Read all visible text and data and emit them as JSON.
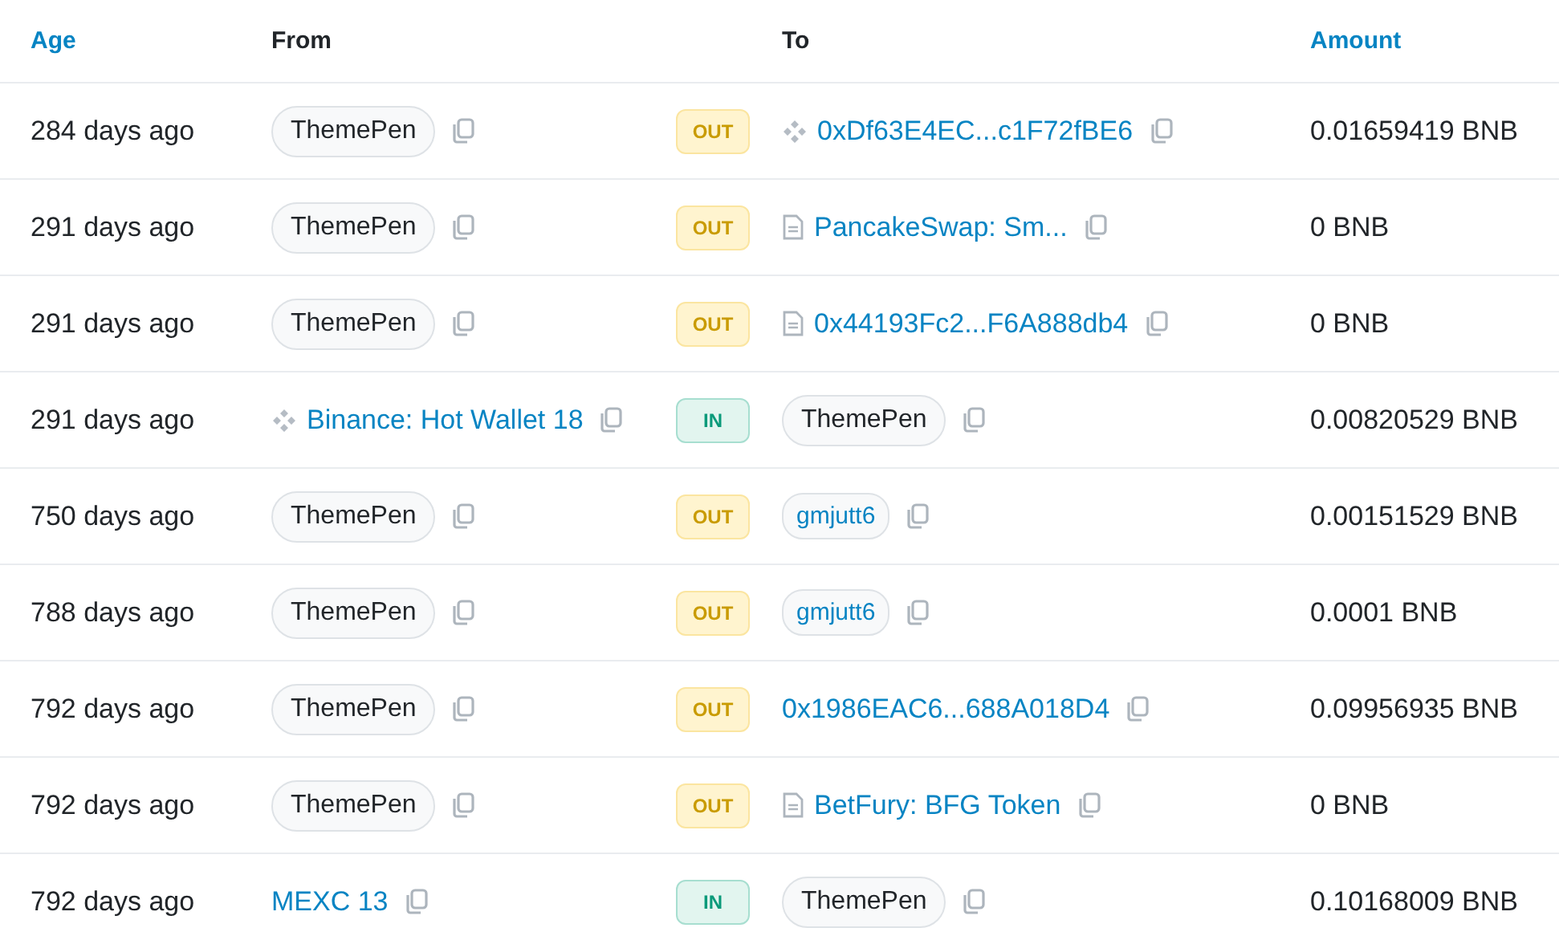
{
  "columns": [
    {
      "label": "Age",
      "kind": "link"
    },
    {
      "label": "From",
      "kind": "plain"
    },
    {
      "label": "To",
      "kind": "plain"
    },
    {
      "label": "Amount",
      "kind": "link"
    }
  ],
  "rows": [
    {
      "age": "284 days ago",
      "from": {
        "text": "ThemePen",
        "kind": "pill"
      },
      "direction": {
        "label": "OUT",
        "kind": "out"
      },
      "to": {
        "text": "0xDf63E4EC...c1F72fBE6",
        "kind": "exchange-link"
      },
      "amount": "0.01659419 BNB"
    },
    {
      "age": "291 days ago",
      "from": {
        "text": "ThemePen",
        "kind": "pill"
      },
      "direction": {
        "label": "OUT",
        "kind": "out"
      },
      "to": {
        "text": "PancakeSwap: Sm...",
        "kind": "contract-link"
      },
      "amount": "0 BNB"
    },
    {
      "age": "291 days ago",
      "from": {
        "text": "ThemePen",
        "kind": "pill"
      },
      "direction": {
        "label": "OUT",
        "kind": "out"
      },
      "to": {
        "text": "0x44193Fc2...F6A888db4",
        "kind": "contract-link"
      },
      "amount": "0 BNB"
    },
    {
      "age": "291 days ago",
      "from": {
        "text": "Binance: Hot Wallet 18",
        "kind": "exchange-link"
      },
      "direction": {
        "label": "IN",
        "kind": "in"
      },
      "to": {
        "text": "ThemePen",
        "kind": "pill"
      },
      "amount": "0.00820529 BNB"
    },
    {
      "age": "750 days ago",
      "from": {
        "text": "ThemePen",
        "kind": "pill"
      },
      "direction": {
        "label": "OUT",
        "kind": "out"
      },
      "to": {
        "text": "gmjutt6",
        "kind": "pill-link"
      },
      "amount": "0.00151529 BNB"
    },
    {
      "age": "788 days ago",
      "from": {
        "text": "ThemePen",
        "kind": "pill"
      },
      "direction": {
        "label": "OUT",
        "kind": "out"
      },
      "to": {
        "text": "gmjutt6",
        "kind": "pill-link"
      },
      "amount": "0.0001 BNB"
    },
    {
      "age": "792 days ago",
      "from": {
        "text": "ThemePen",
        "kind": "pill"
      },
      "direction": {
        "label": "OUT",
        "kind": "out"
      },
      "to": {
        "text": "0x1986EAC6...688A018D4",
        "kind": "link"
      },
      "amount": "0.09956935 BNB"
    },
    {
      "age": "792 days ago",
      "from": {
        "text": "ThemePen",
        "kind": "pill"
      },
      "direction": {
        "label": "OUT",
        "kind": "out"
      },
      "to": {
        "text": "BetFury: BFG Token",
        "kind": "contract-link"
      },
      "amount": "0 BNB"
    },
    {
      "age": "792 days ago",
      "from": {
        "text": "MEXC 13",
        "kind": "link"
      },
      "direction": {
        "label": "IN",
        "kind": "in"
      },
      "to": {
        "text": "ThemePen",
        "kind": "pill"
      },
      "amount": "0.10168009 BNB"
    }
  ]
}
